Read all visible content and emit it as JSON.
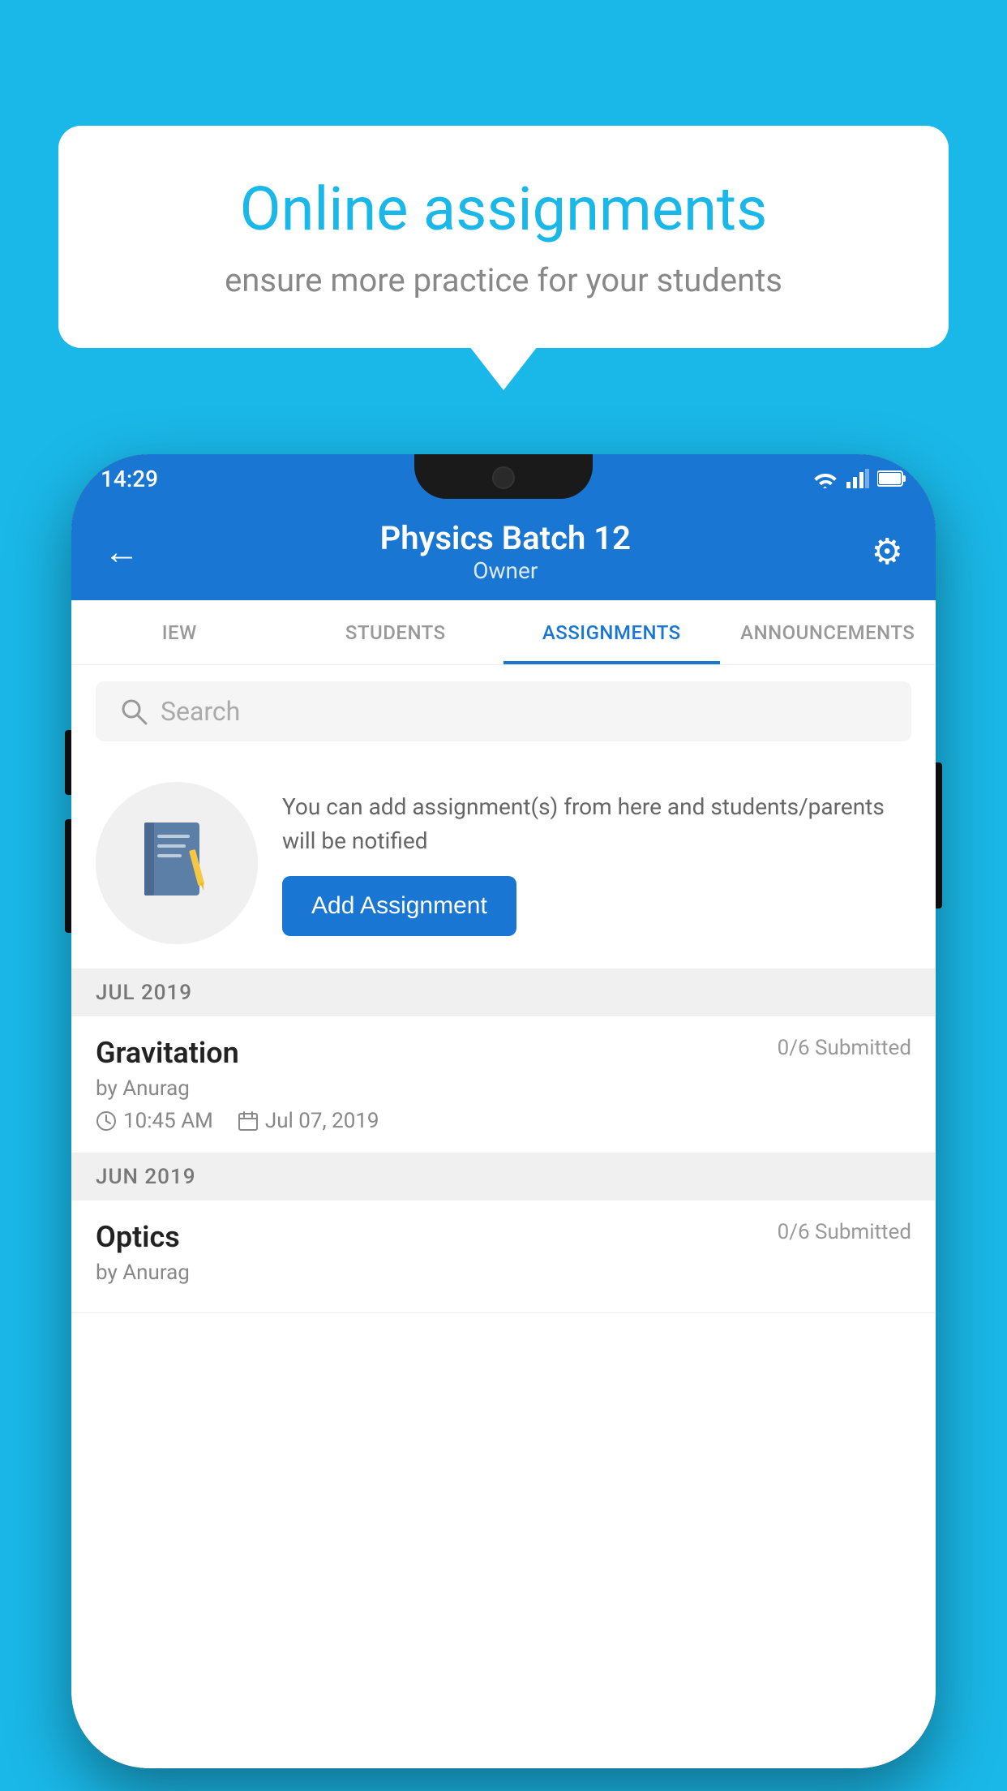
{
  "background_color": "#1ab8e8",
  "speech_bubble": {
    "title": "Online assignments",
    "subtitle": "ensure more practice for your students"
  },
  "phone": {
    "status_bar": {
      "time": "14:29",
      "icons": [
        "wifi",
        "signal",
        "battery"
      ]
    },
    "app_bar": {
      "title": "Physics Batch 12",
      "subtitle": "Owner",
      "back_label": "←",
      "settings_label": "⚙"
    },
    "tabs": [
      {
        "label": "IEW",
        "active": false
      },
      {
        "label": "STUDENTS",
        "active": false
      },
      {
        "label": "ASSIGNMENTS",
        "active": true
      },
      {
        "label": "ANNOUNCEMENTS",
        "active": false
      }
    ],
    "search": {
      "placeholder": "Search"
    },
    "cta": {
      "description": "You can add assignment(s) from here and students/parents will be notified",
      "button_label": "Add Assignment"
    },
    "sections": [
      {
        "header": "JUL 2019",
        "assignments": [
          {
            "name": "Gravitation",
            "submitted": "0/6 Submitted",
            "by": "by Anurag",
            "time": "10:45 AM",
            "date": "Jul 07, 2019"
          }
        ]
      },
      {
        "header": "JUN 2019",
        "assignments": [
          {
            "name": "Optics",
            "submitted": "0/6 Submitted",
            "by": "by Anurag",
            "time": "",
            "date": ""
          }
        ]
      }
    ]
  }
}
